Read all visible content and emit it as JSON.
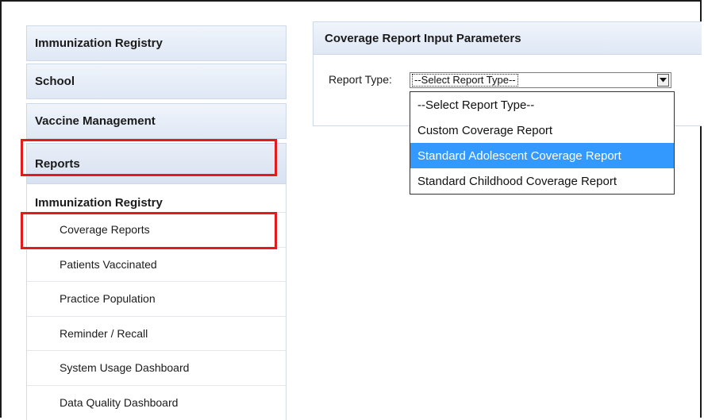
{
  "sidebar": {
    "items": [
      {
        "label": "Immunization Registry"
      },
      {
        "label": "School"
      },
      {
        "label": "Vaccine Management"
      },
      {
        "label": "Reports"
      }
    ],
    "submenu": {
      "title": "Immunization Registry",
      "items": [
        {
          "label": "Coverage Reports"
        },
        {
          "label": "Patients Vaccinated"
        },
        {
          "label": "Practice Population"
        },
        {
          "label": "Reminder / Recall"
        },
        {
          "label": "System Usage Dashboard"
        },
        {
          "label": "Data Quality Dashboard"
        }
      ]
    }
  },
  "panel": {
    "title": "Coverage Report Input Parameters",
    "report_type_label": "Report Type:",
    "selected_value": "--Select Report Type--",
    "options": [
      {
        "label": "--Select Report Type--"
      },
      {
        "label": "Custom Coverage Report"
      },
      {
        "label": "Standard Adolescent Coverage Report"
      },
      {
        "label": "Standard Childhood Coverage Report"
      }
    ],
    "highlighted_option": "Standard Adolescent Coverage Report"
  },
  "colors": {
    "highlight_border": "#e31b1b",
    "selected_option_bg": "#3399ff",
    "header_gradient_top": "#f0f4fb",
    "header_gradient_bottom": "#dfe8f5"
  },
  "icons": {
    "select_arrow": "chevron-down-icon"
  }
}
